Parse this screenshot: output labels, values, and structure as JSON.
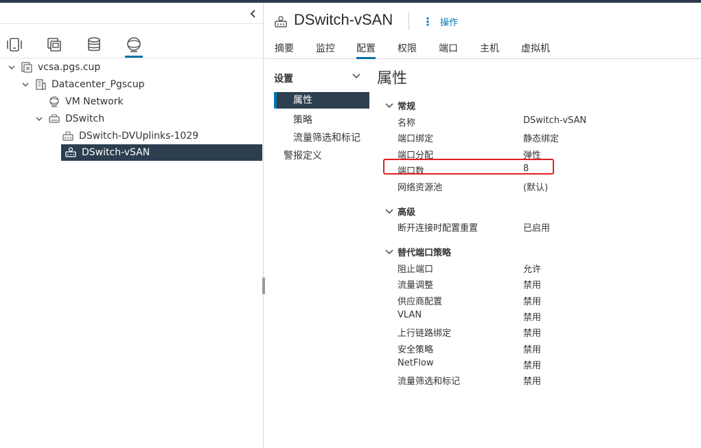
{
  "left": {
    "nav_tabs": [
      {
        "icon": "hosts-clusters-icon"
      },
      {
        "icon": "vms-templates-icon"
      },
      {
        "icon": "storage-icon"
      },
      {
        "icon": "networking-icon",
        "active": true
      }
    ],
    "tree": [
      {
        "label": "vcsa.pgs.cup",
        "icon": "vcenter-icon",
        "expanded": true
      },
      {
        "label": "Datacenter_Pgscup",
        "icon": "datacenter-icon",
        "expanded": true
      },
      {
        "label": "VM Network",
        "icon": "network-icon"
      },
      {
        "label": "DSwitch",
        "icon": "folder-icon",
        "expanded": true
      },
      {
        "label": "DSwitch-DVUplinks-1029",
        "icon": "uplink-portgroup-icon"
      },
      {
        "label": "DSwitch-vSAN",
        "icon": "portgroup-icon",
        "selected": true
      }
    ]
  },
  "header": {
    "title": "DSwitch-vSAN",
    "actions_label": "操作"
  },
  "tabs": [
    {
      "label": "摘要"
    },
    {
      "label": "监控"
    },
    {
      "label": "配置",
      "active": true
    },
    {
      "label": "权限"
    },
    {
      "label": "端口"
    },
    {
      "label": "主机"
    },
    {
      "label": "虚拟机"
    }
  ],
  "subnav": {
    "header": "设置",
    "items": [
      {
        "label": "属性",
        "active": true
      },
      {
        "label": "策略"
      },
      {
        "label": "流量筛选和标记"
      }
    ],
    "alarm_label": "警报定义"
  },
  "content": {
    "title": "属性",
    "groups": [
      {
        "title": "常规",
        "rows": [
          {
            "label": "名称",
            "value": "DSwitch-vSAN"
          },
          {
            "label": "端口绑定",
            "value": "静态绑定"
          },
          {
            "label": "端口分配",
            "value": "弹性"
          },
          {
            "label": "端口数",
            "value": "8"
          },
          {
            "label": "网络资源池",
            "value": "(默认)"
          }
        ]
      },
      {
        "title": "高级",
        "rows": [
          {
            "label": "断开连接时配置重置",
            "value": "已启用"
          }
        ]
      },
      {
        "title": "替代端口策略",
        "rows": [
          {
            "label": "阻止端口",
            "value": "允许"
          },
          {
            "label": "流量调整",
            "value": "禁用"
          },
          {
            "label": "供应商配置",
            "value": "禁用"
          },
          {
            "label": "VLAN",
            "value": "禁用"
          },
          {
            "label": "上行链路绑定",
            "value": "禁用"
          },
          {
            "label": "安全策略",
            "value": "禁用"
          },
          {
            "label": "NetFlow",
            "value": "禁用"
          },
          {
            "label": "流量筛选和标记",
            "value": "禁用"
          }
        ]
      }
    ]
  },
  "colors": {
    "accent": "#0072a3",
    "selected_bg": "#2c3e50",
    "highlight_border": "#e02020"
  }
}
